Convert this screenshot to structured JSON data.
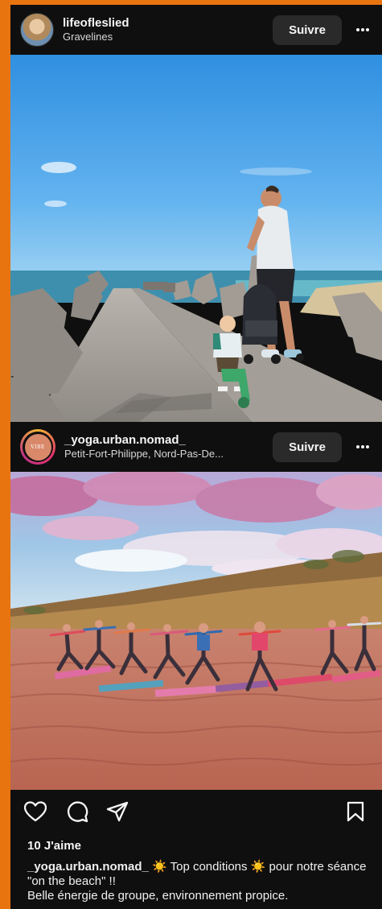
{
  "posts": [
    {
      "username": "lifeofleslied",
      "location": "Gravelines",
      "follow_label": "Suivre"
    },
    {
      "username": "_yoga.urban.nomad_",
      "location": "Petit-Fort-Philippe, Nord-Pas-De...",
      "follow_label": "Suivre",
      "avatar_text": "VIBE"
    }
  ],
  "engagement": {
    "likes": "10 J'aime"
  },
  "caption": {
    "username": "_yoga.urban.nomad_",
    "text_1": " ☀️ Top conditions ☀️ pour notre séance \"on the beach\" !!",
    "text_2": "Belle énergie de groupe, environnement propice."
  },
  "icons": {
    "like": "heart-icon",
    "comment": "comment-icon",
    "share": "share-icon",
    "save": "bookmark-icon",
    "more": "more-horizontal-icon"
  },
  "colors": {
    "frame": "#e8740f",
    "background": "#0f0f0f",
    "button": "#2a2a2a"
  }
}
